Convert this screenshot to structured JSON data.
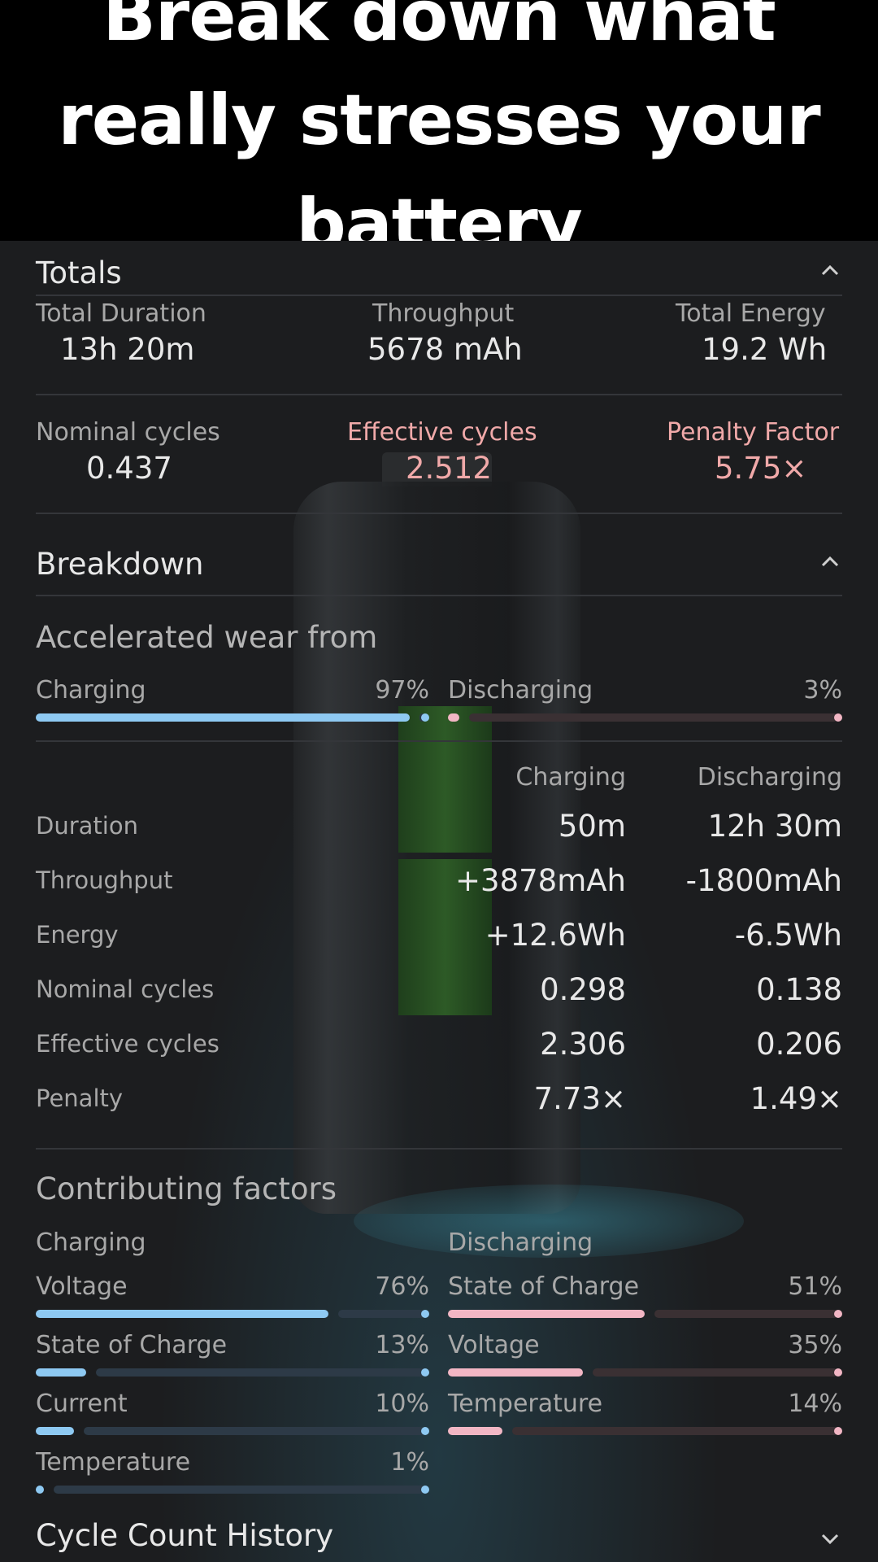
{
  "headline": "Break down what really stresses your battery",
  "totals": {
    "title": "Totals",
    "stats": [
      {
        "label": "Total Duration",
        "value": "13h 20m"
      },
      {
        "label": "Throughput",
        "value": "5678 mAh"
      },
      {
        "label": "Total Energy",
        "value": "19.2 Wh"
      }
    ],
    "stats2": [
      {
        "label": "Nominal cycles",
        "value": "0.437"
      },
      {
        "label": "Effective cycles",
        "value": "2.512"
      },
      {
        "label": "Penalty Factor",
        "value": "5.75×"
      }
    ]
  },
  "breakdown": {
    "title": "Breakdown",
    "wear_title": "Accelerated wear from",
    "charging": {
      "label": "Charging",
      "percent_text": "97%",
      "fraction": 0.97
    },
    "discharging": {
      "label": "Discharging",
      "percent_text": "3%",
      "fraction": 0.03
    },
    "table": {
      "col1": "Charging",
      "col2": "Discharging",
      "rows": [
        {
          "label": "Duration",
          "charging": "50m",
          "discharging": "12h 30m"
        },
        {
          "label": "Throughput",
          "charging": "+3878mAh",
          "discharging": "-1800mAh"
        },
        {
          "label": "Energy",
          "charging": "+12.6Wh",
          "discharging": "-6.5Wh"
        },
        {
          "label": "Nominal cycles",
          "charging": "0.298",
          "discharging": "0.138"
        },
        {
          "label": "Effective cycles",
          "charging": "2.306",
          "discharging": "0.206"
        },
        {
          "label": "Penalty",
          "charging": "7.73×",
          "discharging": "1.49×"
        }
      ]
    }
  },
  "factors": {
    "title": "Contributing factors",
    "charging_title": "Charging",
    "discharging_title": "Discharging",
    "charging": [
      {
        "label": "Voltage",
        "percent_text": "76%",
        "fraction": 0.76
      },
      {
        "label": "State of Charge",
        "percent_text": "13%",
        "fraction": 0.13
      },
      {
        "label": "Current",
        "percent_text": "10%",
        "fraction": 0.1
      },
      {
        "label": "Temperature",
        "percent_text": "1%",
        "fraction": 0.01
      }
    ],
    "discharging": [
      {
        "label": "State of Charge",
        "percent_text": "51%",
        "fraction": 0.51
      },
      {
        "label": "Voltage",
        "percent_text": "35%",
        "fraction": 0.35
      },
      {
        "label": "Temperature",
        "percent_text": "14%",
        "fraction": 0.14
      }
    ]
  },
  "cycle_history": {
    "title": "Cycle Count History"
  },
  "colors": {
    "charging_accent": "#8ec9f2",
    "discharging_accent": "#f2b6c4",
    "highlight_text": "#f0a9a9"
  },
  "icons": {
    "collapse": "chevron-up-icon",
    "expand": "chevron-down-icon"
  }
}
